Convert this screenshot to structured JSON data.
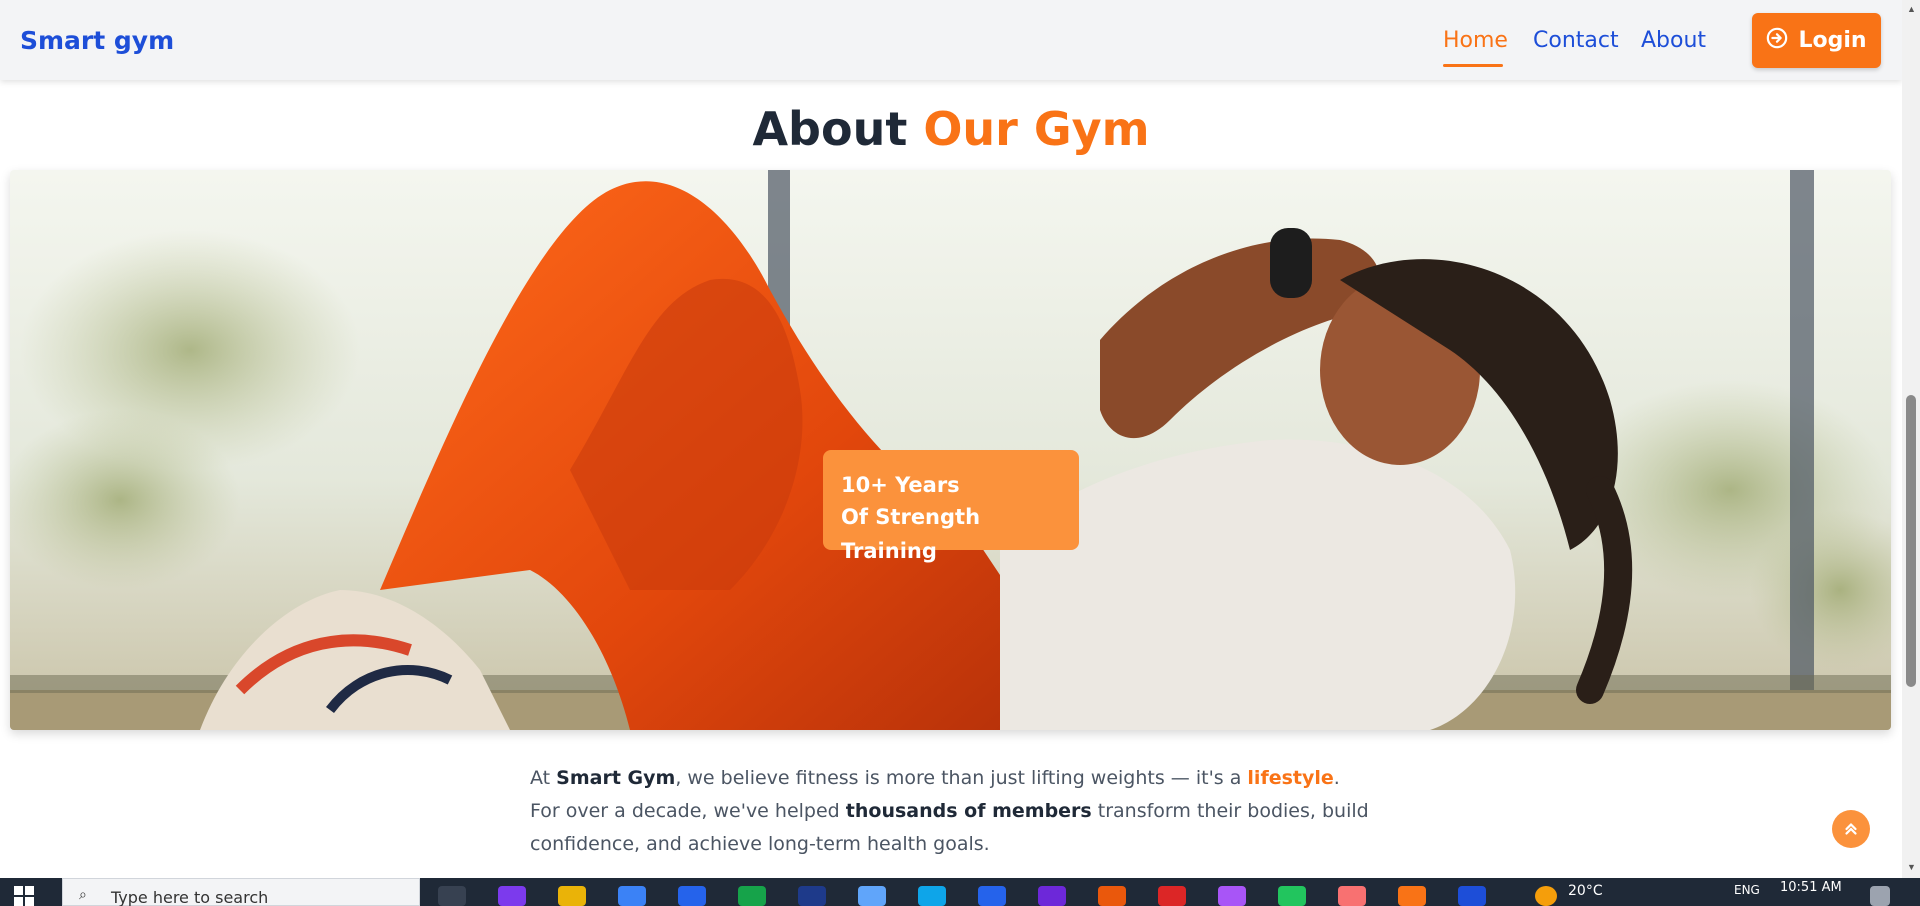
{
  "navbar": {
    "brand": "Smart gym",
    "links": [
      {
        "label": "Home",
        "active": true
      },
      {
        "label": "Contact",
        "active": false
      },
      {
        "label": "About",
        "active": false
      }
    ],
    "login_label": "Login",
    "accent_color": "#f97316",
    "brand_color": "#1d4ed8"
  },
  "section": {
    "title_part1": "About",
    "title_part2": "Our Gym"
  },
  "hero": {
    "badge_line1": "10+ Years",
    "badge_line2": "Of Strength Training"
  },
  "paragraph": {
    "p1": "At ",
    "b1": "Smart Gym",
    "p2": ", we believe fitness is more than just lifting weights — it's a ",
    "hl": "lifestyle",
    "p3": ". For over a decade, we've helped ",
    "b2": "thousands of members",
    "p4": " transform their bodies, build confidence, and achieve long-term health goals."
  },
  "taskbar": {
    "search_placeholder": "Type here to search",
    "weather": "20°C",
    "language": "ENG",
    "time": "10:51 AM"
  }
}
